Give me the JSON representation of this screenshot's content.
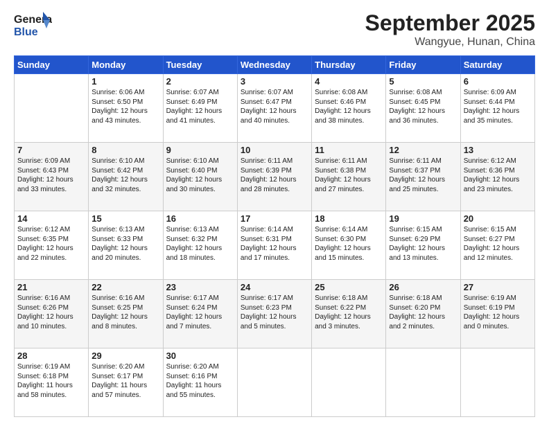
{
  "header": {
    "logo_line1": "General",
    "logo_line2": "Blue",
    "title": "September 2025",
    "subtitle": "Wangyue, Hunan, China"
  },
  "calendar": {
    "days_of_week": [
      "Sunday",
      "Monday",
      "Tuesday",
      "Wednesday",
      "Thursday",
      "Friday",
      "Saturday"
    ],
    "weeks": [
      [
        {
          "day": "",
          "info": ""
        },
        {
          "day": "1",
          "info": "Sunrise: 6:06 AM\nSunset: 6:50 PM\nDaylight: 12 hours\nand 43 minutes."
        },
        {
          "day": "2",
          "info": "Sunrise: 6:07 AM\nSunset: 6:49 PM\nDaylight: 12 hours\nand 41 minutes."
        },
        {
          "day": "3",
          "info": "Sunrise: 6:07 AM\nSunset: 6:47 PM\nDaylight: 12 hours\nand 40 minutes."
        },
        {
          "day": "4",
          "info": "Sunrise: 6:08 AM\nSunset: 6:46 PM\nDaylight: 12 hours\nand 38 minutes."
        },
        {
          "day": "5",
          "info": "Sunrise: 6:08 AM\nSunset: 6:45 PM\nDaylight: 12 hours\nand 36 minutes."
        },
        {
          "day": "6",
          "info": "Sunrise: 6:09 AM\nSunset: 6:44 PM\nDaylight: 12 hours\nand 35 minutes."
        }
      ],
      [
        {
          "day": "7",
          "info": "Sunrise: 6:09 AM\nSunset: 6:43 PM\nDaylight: 12 hours\nand 33 minutes."
        },
        {
          "day": "8",
          "info": "Sunrise: 6:10 AM\nSunset: 6:42 PM\nDaylight: 12 hours\nand 32 minutes."
        },
        {
          "day": "9",
          "info": "Sunrise: 6:10 AM\nSunset: 6:40 PM\nDaylight: 12 hours\nand 30 minutes."
        },
        {
          "day": "10",
          "info": "Sunrise: 6:11 AM\nSunset: 6:39 PM\nDaylight: 12 hours\nand 28 minutes."
        },
        {
          "day": "11",
          "info": "Sunrise: 6:11 AM\nSunset: 6:38 PM\nDaylight: 12 hours\nand 27 minutes."
        },
        {
          "day": "12",
          "info": "Sunrise: 6:11 AM\nSunset: 6:37 PM\nDaylight: 12 hours\nand 25 minutes."
        },
        {
          "day": "13",
          "info": "Sunrise: 6:12 AM\nSunset: 6:36 PM\nDaylight: 12 hours\nand 23 minutes."
        }
      ],
      [
        {
          "day": "14",
          "info": "Sunrise: 6:12 AM\nSunset: 6:35 PM\nDaylight: 12 hours\nand 22 minutes."
        },
        {
          "day": "15",
          "info": "Sunrise: 6:13 AM\nSunset: 6:33 PM\nDaylight: 12 hours\nand 20 minutes."
        },
        {
          "day": "16",
          "info": "Sunrise: 6:13 AM\nSunset: 6:32 PM\nDaylight: 12 hours\nand 18 minutes."
        },
        {
          "day": "17",
          "info": "Sunrise: 6:14 AM\nSunset: 6:31 PM\nDaylight: 12 hours\nand 17 minutes."
        },
        {
          "day": "18",
          "info": "Sunrise: 6:14 AM\nSunset: 6:30 PM\nDaylight: 12 hours\nand 15 minutes."
        },
        {
          "day": "19",
          "info": "Sunrise: 6:15 AM\nSunset: 6:29 PM\nDaylight: 12 hours\nand 13 minutes."
        },
        {
          "day": "20",
          "info": "Sunrise: 6:15 AM\nSunset: 6:27 PM\nDaylight: 12 hours\nand 12 minutes."
        }
      ],
      [
        {
          "day": "21",
          "info": "Sunrise: 6:16 AM\nSunset: 6:26 PM\nDaylight: 12 hours\nand 10 minutes."
        },
        {
          "day": "22",
          "info": "Sunrise: 6:16 AM\nSunset: 6:25 PM\nDaylight: 12 hours\nand 8 minutes."
        },
        {
          "day": "23",
          "info": "Sunrise: 6:17 AM\nSunset: 6:24 PM\nDaylight: 12 hours\nand 7 minutes."
        },
        {
          "day": "24",
          "info": "Sunrise: 6:17 AM\nSunset: 6:23 PM\nDaylight: 12 hours\nand 5 minutes."
        },
        {
          "day": "25",
          "info": "Sunrise: 6:18 AM\nSunset: 6:22 PM\nDaylight: 12 hours\nand 3 minutes."
        },
        {
          "day": "26",
          "info": "Sunrise: 6:18 AM\nSunset: 6:20 PM\nDaylight: 12 hours\nand 2 minutes."
        },
        {
          "day": "27",
          "info": "Sunrise: 6:19 AM\nSunset: 6:19 PM\nDaylight: 12 hours\nand 0 minutes."
        }
      ],
      [
        {
          "day": "28",
          "info": "Sunrise: 6:19 AM\nSunset: 6:18 PM\nDaylight: 11 hours\nand 58 minutes."
        },
        {
          "day": "29",
          "info": "Sunrise: 6:20 AM\nSunset: 6:17 PM\nDaylight: 11 hours\nand 57 minutes."
        },
        {
          "day": "30",
          "info": "Sunrise: 6:20 AM\nSunset: 6:16 PM\nDaylight: 11 hours\nand 55 minutes."
        },
        {
          "day": "",
          "info": ""
        },
        {
          "day": "",
          "info": ""
        },
        {
          "day": "",
          "info": ""
        },
        {
          "day": "",
          "info": ""
        }
      ]
    ]
  }
}
